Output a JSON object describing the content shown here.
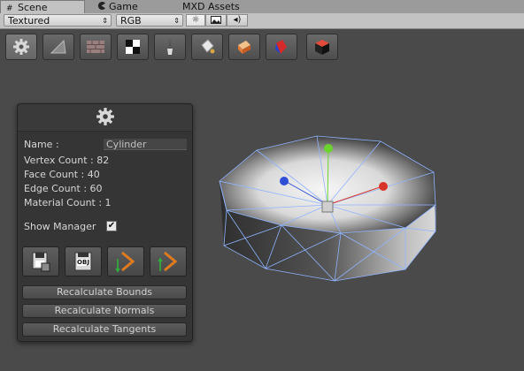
{
  "tabs": [
    {
      "label": "Scene",
      "icon": "grid-icon"
    },
    {
      "label": "Game",
      "icon": "pacman-icon"
    },
    {
      "label": "MXD Assets",
      "icon": ""
    }
  ],
  "toolbar": {
    "render_mode": "Textured",
    "color_mode": "RGB",
    "toggles": [
      "sun-icon",
      "image-icon",
      "audio-icon"
    ]
  },
  "tools": [
    "gear-icon",
    "triangle-icon",
    "brick-icon",
    "checker-icon",
    "brush-icon",
    "paint-bucket-icon",
    "box-paint-icon",
    "gem-icon",
    "cube-icon"
  ],
  "panel": {
    "header_icon": "gear-icon",
    "name_label": "Name :",
    "name_value": "Cylinder",
    "vertex_count": "Vertex Count : 82",
    "face_count": "Face Count : 40",
    "edge_count": "Edge Count : 60",
    "material_count": "Material Count : 1",
    "show_manager_label": "Show Manager",
    "show_manager_checked": true,
    "check_glyph": "✔",
    "obj_label": "OBJ",
    "action_buttons": [
      "save-mesh-icon",
      "export-obj-icon",
      "play-import-icon",
      "play-export-icon"
    ],
    "recalc_bounds": "Recalculate Bounds",
    "recalc_normals": "Recalculate Normals",
    "recalc_tangents": "Recalculate Tangents"
  },
  "colors": {
    "axis_x": "#d9342a",
    "axis_y": "#6ad42c",
    "axis_z": "#2f4ed8",
    "wire": "#8fb4ff"
  }
}
